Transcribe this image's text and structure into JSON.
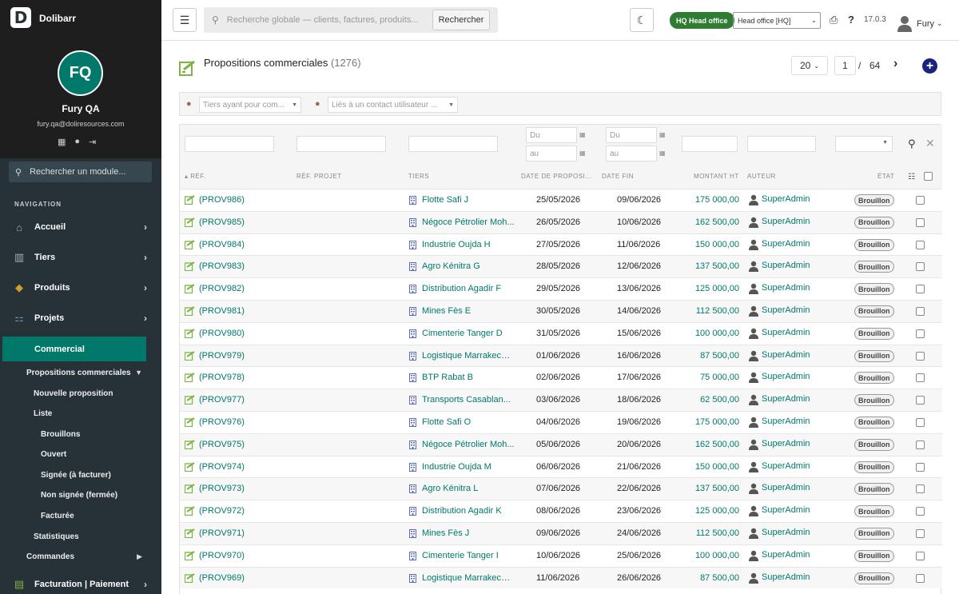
{
  "app": {
    "name": "Dolibarr",
    "logo_letter": "D"
  },
  "user": {
    "initials": "FQ",
    "name": "Fury QA",
    "email": "fury.qa@doliresources.com"
  },
  "sidebar": {
    "search_placeholder": "Rechercher un module...",
    "nav_title": "NAVIGATION",
    "items": [
      {
        "label": "Accueil",
        "icon": "home-icon"
      },
      {
        "label": "Tiers",
        "icon": "building-icon"
      },
      {
        "label": "Produits",
        "icon": "cube-icon"
      },
      {
        "label": "Projets",
        "icon": "project-icon"
      },
      {
        "label": "Commercial",
        "icon": "",
        "active": true
      },
      {
        "label": "Facturation | Paiement",
        "icon": "invoice-icon"
      }
    ],
    "sub": {
      "propositions": "Propositions commerciales",
      "nouvelle": "Nouvelle proposition",
      "liste": "Liste",
      "brouillons": "Brouillons",
      "ouvert": "Ouvert",
      "signee": "Signée (à facturer)",
      "non_signee": "Non signée (fermée)",
      "facturee": "Facturée",
      "statistiques": "Statistiques",
      "commandes": "Commandes"
    }
  },
  "topbar": {
    "search_placeholder": "Recherche globale — clients, factures, produits...",
    "search_button": "Rechercher",
    "entity_badge": "HQ Head office",
    "entity_select": "Head office [HQ]",
    "version": "17.0.3",
    "user_name": "Fury"
  },
  "page": {
    "title": "Propositions commerciales",
    "count": "(1276)",
    "per_page": "20",
    "current_page": "1",
    "page_sep": "/",
    "total_pages": "64"
  },
  "filters": {
    "tiers_placeholder": "Tiers ayant pour com...",
    "contact_placeholder": "Liés à un contact utilisateur ..."
  },
  "search_row": {
    "date_from": "Du",
    "date_to": "au",
    "fin_from": "Du",
    "fin_to": "au"
  },
  "columns": {
    "ref": "RÉF.",
    "ref_projet": "RÉF. PROJET",
    "tiers": "TIERS",
    "date": "DATE DE PROPOSI...",
    "date_fin": "DATE FIN",
    "montant": "MONTANT HT",
    "auteur": "AUTEUR",
    "etat": "ÉTAT"
  },
  "rows": [
    {
      "ref": "(PROV986)",
      "tiers": "Flotte Safi J",
      "date": "25/05/2026",
      "fin": "09/06/2026",
      "amount": "175 000,00",
      "author": "SuperAdmin",
      "status": "Brouillon"
    },
    {
      "ref": "(PROV985)",
      "tiers": "Négoce Pétrolier Moh...",
      "date": "26/05/2026",
      "fin": "10/06/2026",
      "amount": "162 500,00",
      "author": "SuperAdmin",
      "status": "Brouillon"
    },
    {
      "ref": "(PROV984)",
      "tiers": "Industrie Oujda H",
      "date": "27/05/2026",
      "fin": "11/06/2026",
      "amount": "150 000,00",
      "author": "SuperAdmin",
      "status": "Brouillon"
    },
    {
      "ref": "(PROV983)",
      "tiers": "Agro Kénitra G",
      "date": "28/05/2026",
      "fin": "12/06/2026",
      "amount": "137 500,00",
      "author": "SuperAdmin",
      "status": "Brouillon"
    },
    {
      "ref": "(PROV982)",
      "tiers": "Distribution Agadir F",
      "date": "29/05/2026",
      "fin": "13/06/2026",
      "amount": "125 000,00",
      "author": "SuperAdmin",
      "status": "Brouillon"
    },
    {
      "ref": "(PROV981)",
      "tiers": "Mines Fès E",
      "date": "30/05/2026",
      "fin": "14/06/2026",
      "amount": "112 500,00",
      "author": "SuperAdmin",
      "status": "Brouillon"
    },
    {
      "ref": "(PROV980)",
      "tiers": "Cimenterie Tanger D",
      "date": "31/05/2026",
      "fin": "15/06/2026",
      "amount": "100 000,00",
      "author": "SuperAdmin",
      "status": "Brouillon"
    },
    {
      "ref": "(PROV979)",
      "tiers": "Logistique Marrakech C",
      "date": "01/06/2026",
      "fin": "16/06/2026",
      "amount": "87 500,00",
      "author": "SuperAdmin",
      "status": "Brouillon"
    },
    {
      "ref": "(PROV978)",
      "tiers": "BTP Rabat B",
      "date": "02/06/2026",
      "fin": "17/06/2026",
      "amount": "75 000,00",
      "author": "SuperAdmin",
      "status": "Brouillon"
    },
    {
      "ref": "(PROV977)",
      "tiers": "Transports Casablan...",
      "date": "03/06/2026",
      "fin": "18/06/2026",
      "amount": "62 500,00",
      "author": "SuperAdmin",
      "status": "Brouillon"
    },
    {
      "ref": "(PROV976)",
      "tiers": "Flotte Safi O",
      "date": "04/06/2026",
      "fin": "19/06/2026",
      "amount": "175 000,00",
      "author": "SuperAdmin",
      "status": "Brouillon"
    },
    {
      "ref": "(PROV975)",
      "tiers": "Négoce Pétrolier Moh...",
      "date": "05/06/2026",
      "fin": "20/06/2026",
      "amount": "162 500,00",
      "author": "SuperAdmin",
      "status": "Brouillon"
    },
    {
      "ref": "(PROV974)",
      "tiers": "Industrie Oujda M",
      "date": "06/06/2026",
      "fin": "21/06/2026",
      "amount": "150 000,00",
      "author": "SuperAdmin",
      "status": "Brouillon"
    },
    {
      "ref": "(PROV973)",
      "tiers": "Agro Kénitra L",
      "date": "07/06/2026",
      "fin": "22/06/2026",
      "amount": "137 500,00",
      "author": "SuperAdmin",
      "status": "Brouillon"
    },
    {
      "ref": "(PROV972)",
      "tiers": "Distribution Agadir K",
      "date": "08/06/2026",
      "fin": "23/06/2026",
      "amount": "125 000,00",
      "author": "SuperAdmin",
      "status": "Brouillon"
    },
    {
      "ref": "(PROV971)",
      "tiers": "Mines Fès J",
      "date": "09/06/2026",
      "fin": "24/06/2026",
      "amount": "112 500,00",
      "author": "SuperAdmin",
      "status": "Brouillon"
    },
    {
      "ref": "(PROV970)",
      "tiers": "Cimenterie Tanger I",
      "date": "10/06/2026",
      "fin": "25/06/2026",
      "amount": "100 000,00",
      "author": "SuperAdmin",
      "status": "Brouillon"
    },
    {
      "ref": "(PROV969)",
      "tiers": "Logistique Marrakech H",
      "date": "11/06/2026",
      "fin": "26/06/2026",
      "amount": "87 500,00",
      "author": "SuperAdmin",
      "status": "Brouillon"
    }
  ],
  "colors": {
    "accent": "#00796b",
    "sidebar": "#263238",
    "badge_green": "#2e7d32",
    "add_button": "#1a237e"
  }
}
